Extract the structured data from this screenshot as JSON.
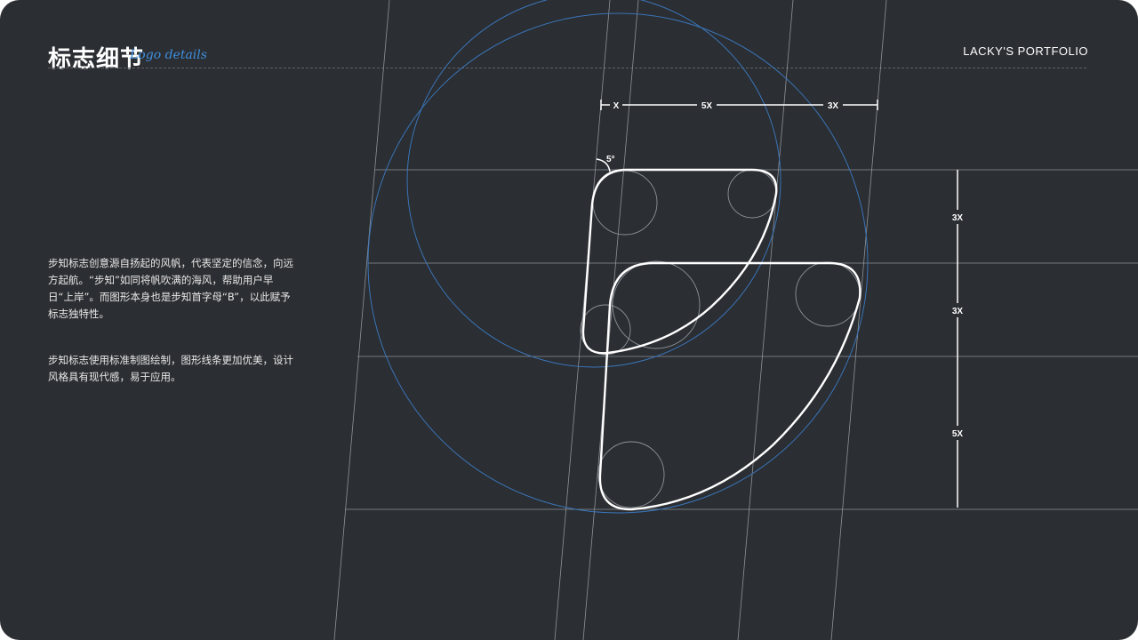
{
  "header": {
    "title": "标志细节",
    "subtitle": "Logo details",
    "brand": "LACKY'S  PORTFOLIO"
  },
  "description": {
    "paragraph1": "步知标志创意源自扬起的风帆，代表坚定的信念，向远方起航。“步知”如同将帆吹满的海风，帮助用户早日“上岸”。而图形本身也是步知首字母“B”，以此赋予标志独特性。",
    "paragraph2": "步知标志使用标准制图绘制，图形线条更加优美，设计风格具有现代感，易于应用。"
  },
  "construction": {
    "angle_label": "5°",
    "horizontal_dims": [
      "X",
      "5X",
      "3X"
    ],
    "vertical_dims": [
      "3X",
      "3X",
      "5X"
    ],
    "colors": {
      "background": "#2b2e32",
      "guide_lines": "#9aa0a6",
      "circles": "#3a74b8",
      "logo_stroke": "#ffffff",
      "accent": "#3f8fe0"
    }
  }
}
